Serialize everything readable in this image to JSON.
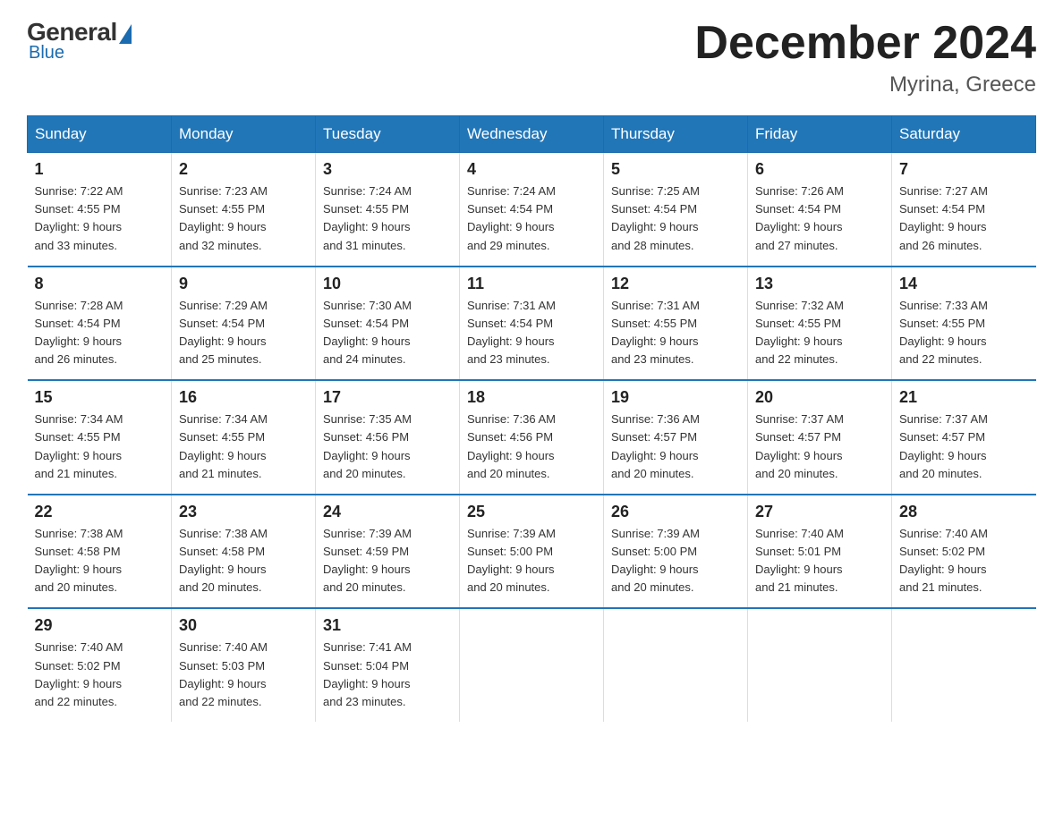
{
  "logo": {
    "general": "General",
    "blue": "Blue",
    "subtitle": "Blue"
  },
  "header": {
    "title": "December 2024",
    "subtitle": "Myrina, Greece"
  },
  "weekdays": [
    "Sunday",
    "Monday",
    "Tuesday",
    "Wednesday",
    "Thursday",
    "Friday",
    "Saturday"
  ],
  "weeks": [
    [
      {
        "day": "1",
        "sunrise": "7:22 AM",
        "sunset": "4:55 PM",
        "daylight": "9 hours and 33 minutes."
      },
      {
        "day": "2",
        "sunrise": "7:23 AM",
        "sunset": "4:55 PM",
        "daylight": "9 hours and 32 minutes."
      },
      {
        "day": "3",
        "sunrise": "7:24 AM",
        "sunset": "4:55 PM",
        "daylight": "9 hours and 31 minutes."
      },
      {
        "day": "4",
        "sunrise": "7:24 AM",
        "sunset": "4:54 PM",
        "daylight": "9 hours and 29 minutes."
      },
      {
        "day": "5",
        "sunrise": "7:25 AM",
        "sunset": "4:54 PM",
        "daylight": "9 hours and 28 minutes."
      },
      {
        "day": "6",
        "sunrise": "7:26 AM",
        "sunset": "4:54 PM",
        "daylight": "9 hours and 27 minutes."
      },
      {
        "day": "7",
        "sunrise": "7:27 AM",
        "sunset": "4:54 PM",
        "daylight": "9 hours and 26 minutes."
      }
    ],
    [
      {
        "day": "8",
        "sunrise": "7:28 AM",
        "sunset": "4:54 PM",
        "daylight": "9 hours and 26 minutes."
      },
      {
        "day": "9",
        "sunrise": "7:29 AM",
        "sunset": "4:54 PM",
        "daylight": "9 hours and 25 minutes."
      },
      {
        "day": "10",
        "sunrise": "7:30 AM",
        "sunset": "4:54 PM",
        "daylight": "9 hours and 24 minutes."
      },
      {
        "day": "11",
        "sunrise": "7:31 AM",
        "sunset": "4:54 PM",
        "daylight": "9 hours and 23 minutes."
      },
      {
        "day": "12",
        "sunrise": "7:31 AM",
        "sunset": "4:55 PM",
        "daylight": "9 hours and 23 minutes."
      },
      {
        "day": "13",
        "sunrise": "7:32 AM",
        "sunset": "4:55 PM",
        "daylight": "9 hours and 22 minutes."
      },
      {
        "day": "14",
        "sunrise": "7:33 AM",
        "sunset": "4:55 PM",
        "daylight": "9 hours and 22 minutes."
      }
    ],
    [
      {
        "day": "15",
        "sunrise": "7:34 AM",
        "sunset": "4:55 PM",
        "daylight": "9 hours and 21 minutes."
      },
      {
        "day": "16",
        "sunrise": "7:34 AM",
        "sunset": "4:55 PM",
        "daylight": "9 hours and 21 minutes."
      },
      {
        "day": "17",
        "sunrise": "7:35 AM",
        "sunset": "4:56 PM",
        "daylight": "9 hours and 20 minutes."
      },
      {
        "day": "18",
        "sunrise": "7:36 AM",
        "sunset": "4:56 PM",
        "daylight": "9 hours and 20 minutes."
      },
      {
        "day": "19",
        "sunrise": "7:36 AM",
        "sunset": "4:57 PM",
        "daylight": "9 hours and 20 minutes."
      },
      {
        "day": "20",
        "sunrise": "7:37 AM",
        "sunset": "4:57 PM",
        "daylight": "9 hours and 20 minutes."
      },
      {
        "day": "21",
        "sunrise": "7:37 AM",
        "sunset": "4:57 PM",
        "daylight": "9 hours and 20 minutes."
      }
    ],
    [
      {
        "day": "22",
        "sunrise": "7:38 AM",
        "sunset": "4:58 PM",
        "daylight": "9 hours and 20 minutes."
      },
      {
        "day": "23",
        "sunrise": "7:38 AM",
        "sunset": "4:58 PM",
        "daylight": "9 hours and 20 minutes."
      },
      {
        "day": "24",
        "sunrise": "7:39 AM",
        "sunset": "4:59 PM",
        "daylight": "9 hours and 20 minutes."
      },
      {
        "day": "25",
        "sunrise": "7:39 AM",
        "sunset": "5:00 PM",
        "daylight": "9 hours and 20 minutes."
      },
      {
        "day": "26",
        "sunrise": "7:39 AM",
        "sunset": "5:00 PM",
        "daylight": "9 hours and 20 minutes."
      },
      {
        "day": "27",
        "sunrise": "7:40 AM",
        "sunset": "5:01 PM",
        "daylight": "9 hours and 21 minutes."
      },
      {
        "day": "28",
        "sunrise": "7:40 AM",
        "sunset": "5:02 PM",
        "daylight": "9 hours and 21 minutes."
      }
    ],
    [
      {
        "day": "29",
        "sunrise": "7:40 AM",
        "sunset": "5:02 PM",
        "daylight": "9 hours and 22 minutes."
      },
      {
        "day": "30",
        "sunrise": "7:40 AM",
        "sunset": "5:03 PM",
        "daylight": "9 hours and 22 minutes."
      },
      {
        "day": "31",
        "sunrise": "7:41 AM",
        "sunset": "5:04 PM",
        "daylight": "9 hours and 23 minutes."
      },
      null,
      null,
      null,
      null
    ]
  ],
  "labels": {
    "sunrise": "Sunrise:",
    "sunset": "Sunset:",
    "daylight": "Daylight:"
  }
}
